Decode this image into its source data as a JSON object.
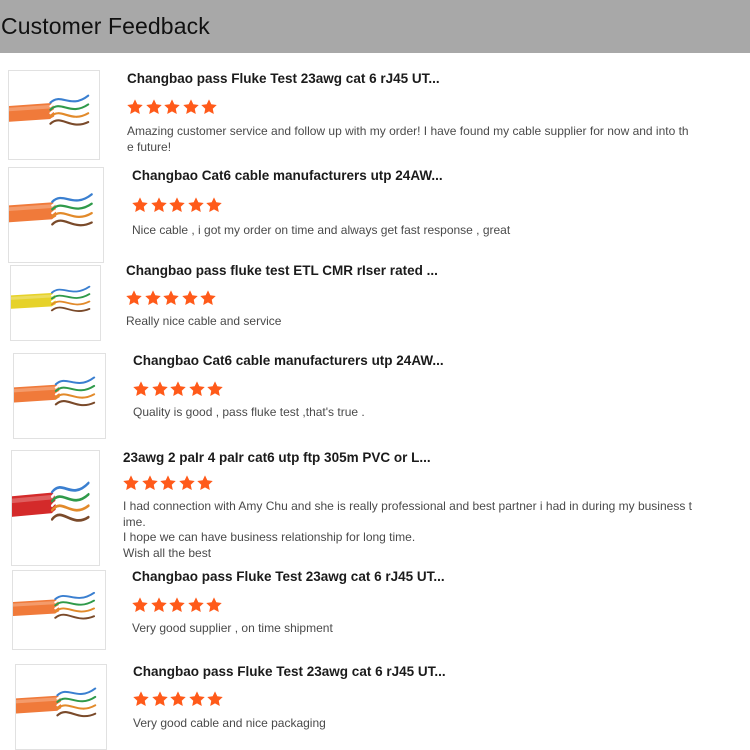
{
  "header": {
    "title": "Customer Feedback"
  },
  "colors": {
    "star": "#ff5a1a",
    "header_bg": "#a8a8a8"
  },
  "reviews": [
    {
      "product_title": "Changbao pass Fluke Test 23awg cat 6 rJ45 UT...",
      "rating": 5,
      "cable_color": "#f07a3a",
      "comment": "Amazing customer service and follow up with my order! I have found my cable supplier for now and into th\ne future!"
    },
    {
      "product_title": "Changbao Cat6 cable manufacturers utp 24AW...",
      "rating": 5,
      "cable_color": "#f07a3a",
      "comment": "Nice cable , i got my order on time and always get fast response , great"
    },
    {
      "product_title": "Changbao pass fluke test ETL CMR rIser rated ...",
      "rating": 5,
      "cable_color": "#e6d22a",
      "comment": "Really nice cable and service"
    },
    {
      "product_title": "Changbao Cat6 cable manufacturers utp 24AW...",
      "rating": 5,
      "cable_color": "#f07a3a",
      "comment": "Quality is good , pass fluke test ,that's true ."
    },
    {
      "product_title": "23awg 2 paIr 4 paIr cat6 utp ftp 305m PVC or L...",
      "rating": 5,
      "cable_color": "#d42a2a",
      "comment": "I had connection with Amy Chu and she is really professional and best partner i had in during my business t\nime.\nI hope we can have business relationship for long time.\nWish all the best"
    },
    {
      "product_title": "Changbao pass Fluke Test 23awg cat 6 rJ45 UT...",
      "rating": 5,
      "cable_color": "#f07a3a",
      "comment": "Very good supplier , on time shipment"
    },
    {
      "product_title": "Changbao pass Fluke Test 23awg cat 6 rJ45 UT...",
      "rating": 5,
      "cable_color": "#f07a3a",
      "comment": "Very good cable and nice packaging"
    }
  ]
}
